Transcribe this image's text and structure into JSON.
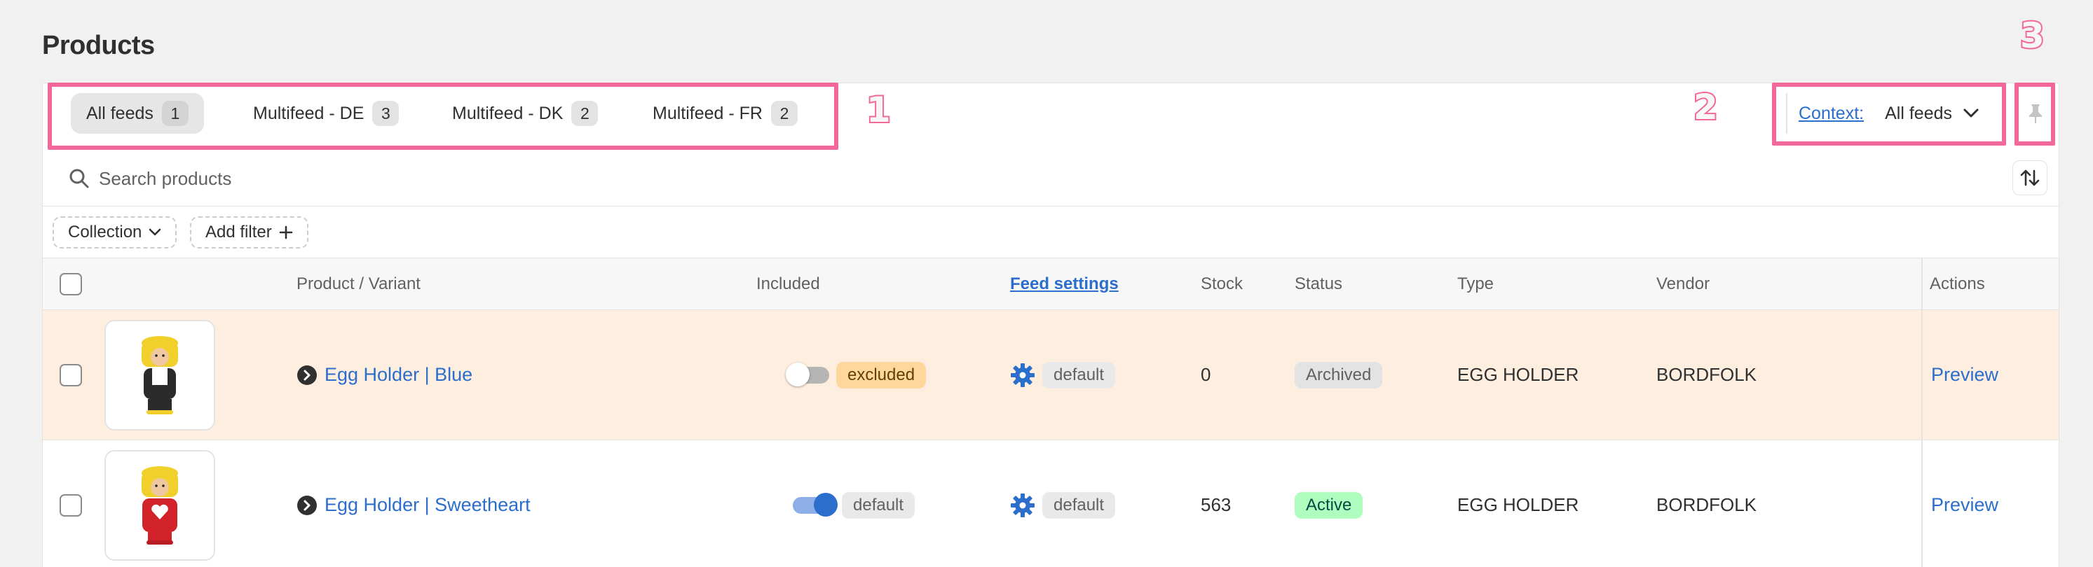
{
  "page": {
    "title": "Products"
  },
  "tabs": [
    {
      "label": "All feeds",
      "count": "1",
      "active": true
    },
    {
      "label": "Multifeed - DE",
      "count": "3",
      "active": false
    },
    {
      "label": "Multifeed - DK",
      "count": "2",
      "active": false
    },
    {
      "label": "Multifeed - FR",
      "count": "2",
      "active": false
    }
  ],
  "context": {
    "label": "Context:",
    "value": "All feeds"
  },
  "search": {
    "placeholder": "Search products"
  },
  "filters": {
    "collection": "Collection",
    "add_filter": "Add filter"
  },
  "table": {
    "headers": {
      "product": "Product / Variant",
      "included": "Included",
      "feed_settings": "Feed settings",
      "stock": "Stock",
      "status": "Status",
      "type": "Type",
      "vendor": "Vendor",
      "actions": "Actions"
    },
    "rows": [
      {
        "name": "Egg Holder | Blue",
        "included_badge": "excluded",
        "included_on": false,
        "feed_setting": "default",
        "stock": "0",
        "status": "Archived",
        "type": "EGG HOLDER",
        "vendor": "BORDFOLK",
        "action": "Preview",
        "thumb_color": "#2b2b2b"
      },
      {
        "name": "Egg Holder | Sweetheart",
        "included_badge": "default",
        "included_on": true,
        "feed_setting": "default",
        "stock": "563",
        "status": "Active",
        "type": "EGG HOLDER",
        "vendor": "BORDFOLK",
        "action": "Preview",
        "thumb_color": "#d2232a"
      }
    ]
  },
  "annotations": {
    "one": "1",
    "two": "2",
    "three": "3"
  },
  "colors": {
    "accent": "#2c6ecb",
    "annotation": "#f2689a",
    "excluded_row": "#fdeee0"
  }
}
